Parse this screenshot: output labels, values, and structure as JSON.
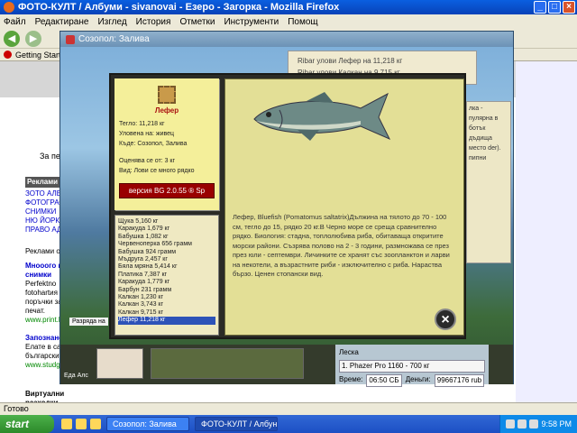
{
  "browser": {
    "title": "ФОТО-КУЛТ / Албуми - sivanovai - Езеро - Загорка - Mozilla Firefox",
    "menu": [
      "Файл",
      "Редактиране",
      "Изглед",
      "История",
      "Отметки",
      "Инструменти",
      "Помощ"
    ],
    "bookmark": "Getting Started",
    "status": "Готово"
  },
  "page": {
    "zaper": "За пер",
    "reklami": "Реклами с",
    "links": [
      "ЗОТО АЛБ",
      "ФОТОГРАФ",
      "СНИМКИ",
      "НЮ ЙОРК",
      "ПРАВО АД"
    ],
    "reklami2": "Реклами от Go",
    "ad_title": "Мнооого го снимки",
    "ad_text": "Perfektno fotohartия поръчки за печат.",
    "ad_url": "www.print.bg",
    "ad2_title": "Запознанс",
    "ad2_text": "Елате в сайт българскит",
    "ad2_url": "www.studgrad.",
    "virt": "Виртуални разходки"
  },
  "game": {
    "window_title": "Созопол: Залива",
    "catch_notes": [
      "Ribar улови Лефер на 11,218 кг",
      "Ribar улови Калкан на 9,715 кг"
    ],
    "fish_card": {
      "name": "Лефер",
      "weight": "Тегло: 11,218 кг",
      "bait": "Уловена на: живец",
      "place": "Къде: Созопол, Залива",
      "score": "Оценява се от: 3 кг",
      "kind": "Вид: Лови се много рядко",
      "version": "версия BG 2.0.55 ® Sp"
    },
    "catch_list": [
      "Щука 5,160 кг",
      "Каракуда 1,679 кг",
      "Бабушка 1,082 кг",
      "Червеноперка 656 грамм",
      "Бабушка 924 грамм",
      "Мъдруга 2,457 кг",
      "Бяла мряна 5,414 кг",
      "Платика 7,387 кг",
      "Каракуда 1,779 кг",
      "Барбун 231 грамм",
      "Калкан 1,230 кг",
      "Калкан 3,743 кг",
      "Калкан 9,715 кг",
      "Лефер 11,218 кг"
    ],
    "selected_index": 13,
    "description": "Лефер, Bluefish (Pomatomus saltatrix)Дължина на тялото до 70 - 100 см, тегло до 15, рядко 20 кг.В Черно море се среща сравнително рядко. Биология: стадна, топлолюбива риба, обитаваща откритите морски райони. Съзрява полово на 2 - 3 години, размножава се през през юли - септември. Личинките се хранят със зоопланктон и ларви на некотели, а възрастните риби - изключително с риба. Нараства бързо. Ценен стопански вид.",
    "close_symbol": "×",
    "bottom": {
      "eda": "Еда",
      "alt": "Алс",
      "leska": "Леска",
      "rod": "1. Phazer Pro 1160 - 700 кг",
      "time_label": "Време:",
      "time": "06:50 СБ",
      "money_label": "Деньги:",
      "money": "99667176 rub"
    },
    "right_note": "лка - пулярна в ботък дъдища место der). пипни",
    "razryada": "Разряда на"
  },
  "taskbar": {
    "start": "start",
    "tasks": [
      "Созопол: Залива",
      "ФОТО-КУЛТ / Албун..."
    ],
    "clock": "9:58 PM"
  }
}
